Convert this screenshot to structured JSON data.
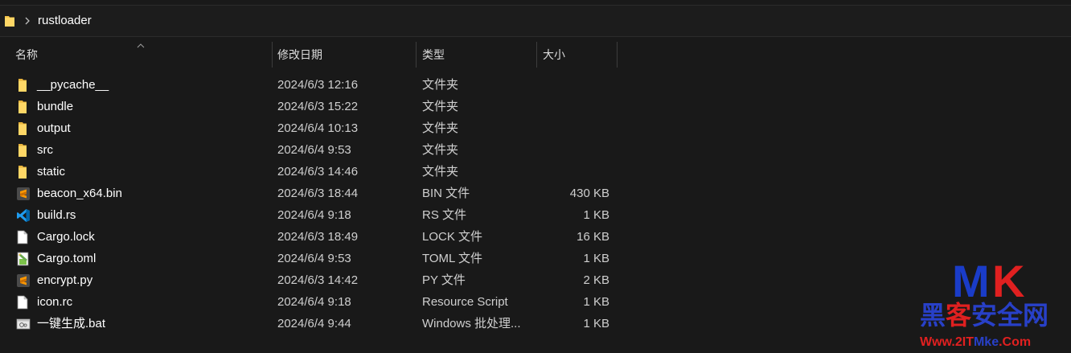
{
  "breadcrumb": {
    "current": "rustloader"
  },
  "columns": {
    "name": "名称",
    "date": "修改日期",
    "type": "类型",
    "size": "大小"
  },
  "files": [
    {
      "name": "__pycache__",
      "date": "2024/6/3 12:16",
      "type": "文件夹",
      "size": "",
      "icon": "folder-icon"
    },
    {
      "name": "bundle",
      "date": "2024/6/3 15:22",
      "type": "文件夹",
      "size": "",
      "icon": "folder-icon"
    },
    {
      "name": "output",
      "date": "2024/6/4 10:13",
      "type": "文件夹",
      "size": "",
      "icon": "folder-icon"
    },
    {
      "name": "src",
      "date": "2024/6/4 9:53",
      "type": "文件夹",
      "size": "",
      "icon": "folder-icon"
    },
    {
      "name": "static",
      "date": "2024/6/3 14:46",
      "type": "文件夹",
      "size": "",
      "icon": "folder-icon"
    },
    {
      "name": "beacon_x64.bin",
      "date": "2024/6/3 18:44",
      "type": "BIN 文件",
      "size": "430 KB",
      "icon": "sublime-text-icon"
    },
    {
      "name": "build.rs",
      "date": "2024/6/4 9:18",
      "type": "RS 文件",
      "size": "1 KB",
      "icon": "vscode-icon"
    },
    {
      "name": "Cargo.lock",
      "date": "2024/6/3 18:49",
      "type": "LOCK 文件",
      "size": "16 KB",
      "icon": "blank-file-icon"
    },
    {
      "name": "Cargo.toml",
      "date": "2024/6/4 9:53",
      "type": "TOML 文件",
      "size": "1 KB",
      "icon": "notepad-plus-icon"
    },
    {
      "name": "encrypt.py",
      "date": "2024/6/3 14:42",
      "type": "PY 文件",
      "size": "2 KB",
      "icon": "sublime-text-icon"
    },
    {
      "name": "icon.rc",
      "date": "2024/6/4 9:18",
      "type": "Resource Script",
      "size": "1 KB",
      "icon": "blank-file-icon"
    },
    {
      "name": "一键生成.bat",
      "date": "2024/6/4 9:44",
      "type": "Windows 批处理...",
      "size": "1 KB",
      "icon": "batch-file-icon"
    }
  ],
  "watermark": {
    "m": "M",
    "k": "K",
    "cn_1": "黑",
    "cn_2": "客",
    "cn_3": "安全网",
    "url_1": "Www.2IT",
    "url_2": "Mke",
    "url_3": ".Com"
  },
  "colors": {
    "background": "#191919",
    "folder": "#f6c54a",
    "sublime": "#ff9800",
    "vscode": "#1f9cf0"
  }
}
